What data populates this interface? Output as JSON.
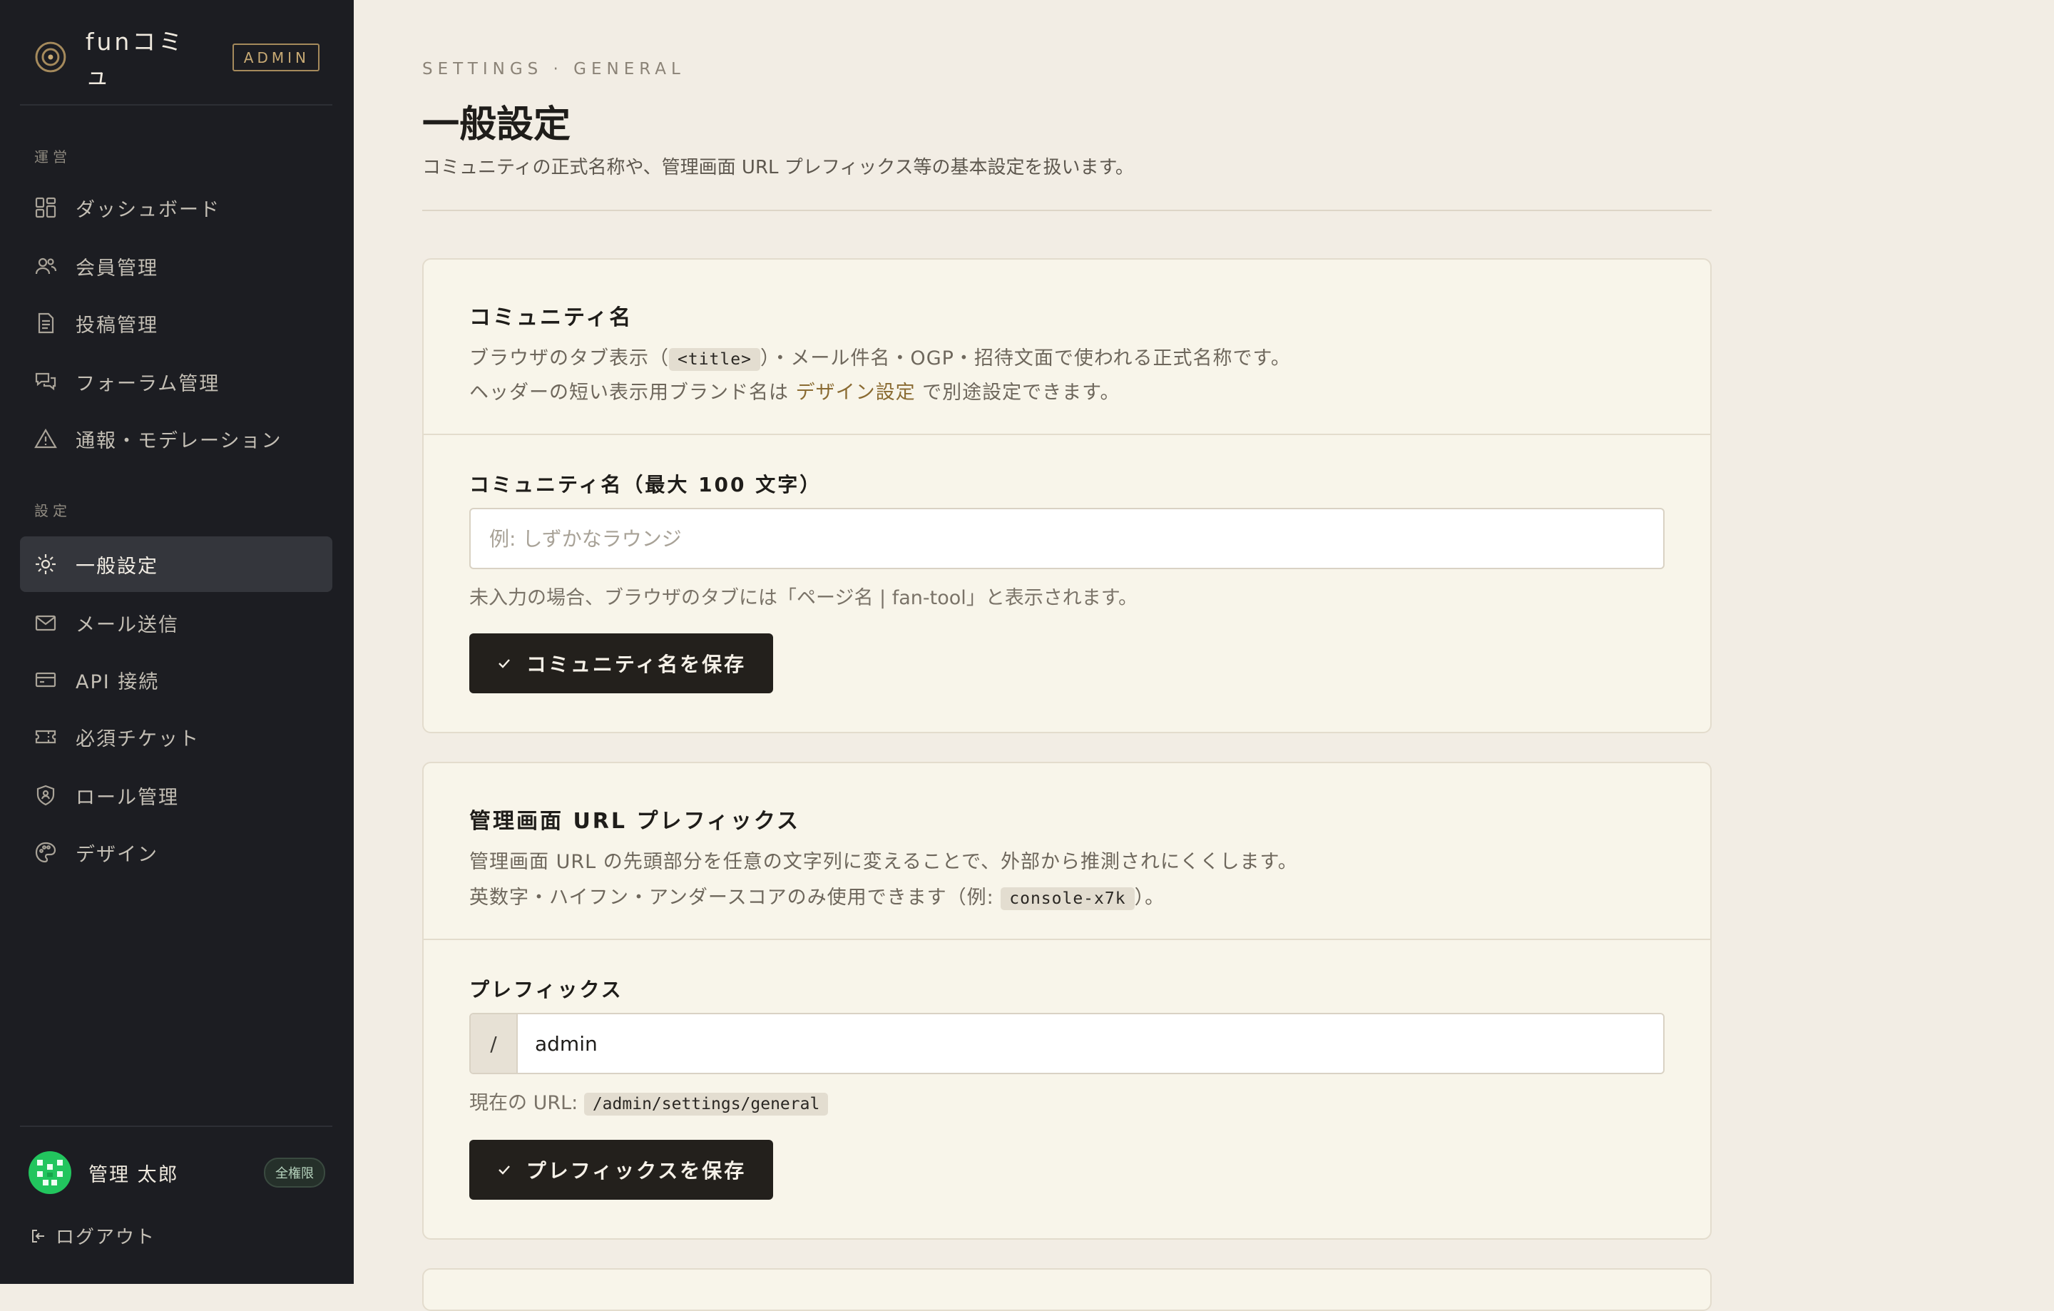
{
  "brand": {
    "name": "funコミュ",
    "badge": "ADMIN"
  },
  "sidebar": {
    "section_ops": "運営",
    "section_settings": "設定",
    "ops_items": [
      {
        "label": "ダッシュボード",
        "icon": "dashboard-icon"
      },
      {
        "label": "会員管理",
        "icon": "users-icon"
      },
      {
        "label": "投稿管理",
        "icon": "document-icon"
      },
      {
        "label": "フォーラム管理",
        "icon": "chat-icon"
      },
      {
        "label": "通報・モデレーション",
        "icon": "warning-icon"
      }
    ],
    "settings_items": [
      {
        "label": "一般設定",
        "icon": "gear-icon",
        "active": true
      },
      {
        "label": "メール送信",
        "icon": "mail-icon"
      },
      {
        "label": "API 接続",
        "icon": "api-icon"
      },
      {
        "label": "必須チケット",
        "icon": "ticket-icon"
      },
      {
        "label": "ロール管理",
        "icon": "shield-icon"
      },
      {
        "label": "デザイン",
        "icon": "palette-icon"
      }
    ],
    "user": {
      "name": "管理 太郎",
      "badge": "全権限"
    },
    "logout": "ログアウト"
  },
  "page": {
    "eyebrow": "SETTINGS · GENERAL",
    "title": "一般設定",
    "description": "コミュニティの正式名称や、管理画面 URL プレフィックス等の基本設定を扱います。"
  },
  "community_card": {
    "title": "コミュニティ名",
    "desc1_pre": "ブラウザのタブ表示（",
    "desc1_code": "<title>",
    "desc1_post": "）・メール件名・OGP・招待文面で使われる正式名称です。",
    "desc2_pre": "ヘッダーの短い表示用ブランド名は ",
    "desc2_link": "デザイン設定",
    "desc2_post": " で別途設定できます。",
    "field_label": "コミュニティ名（最大 100 文字）",
    "placeholder": "例: しずかなラウンジ",
    "value": "",
    "help": "未入力の場合、ブラウザのタブには「ページ名 | fan-tool」と表示されます。",
    "button": "コミュニティ名を保存"
  },
  "prefix_card": {
    "title": "管理画面 URL プレフィックス",
    "desc1": "管理画面 URL の先頭部分を任意の文字列に変えることで、外部から推測されにくくします。",
    "desc2_pre": "英数字・ハイフン・アンダースコアのみ使用できます（例: ",
    "desc2_code": "console-x7k",
    "desc2_post": "）。",
    "field_label": "プレフィックス",
    "slash": "/",
    "value": "admin",
    "current_label": "現在の URL: ",
    "current_url": "/admin/settings/general",
    "button": "プレフィックスを保存"
  },
  "colors": {
    "sidebar_bg": "#1c1d22",
    "page_bg": "#f2ede4",
    "card_bg": "#f8f5ea",
    "accent": "#8a6b32",
    "button_bg": "#23201c"
  }
}
